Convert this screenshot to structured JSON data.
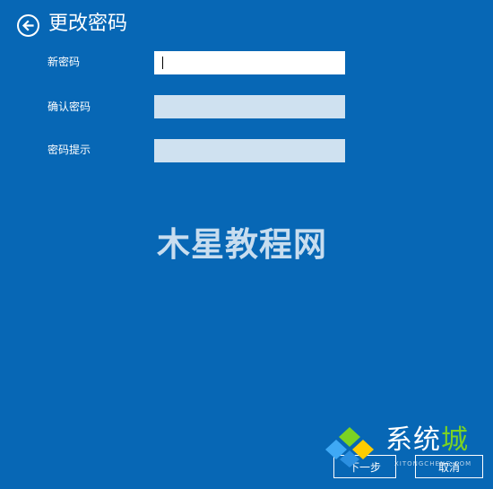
{
  "header": {
    "title": "更改密码",
    "back_icon": "back-arrow-icon"
  },
  "form": {
    "new_password_label": "新密码",
    "new_password_value": "",
    "confirm_password_label": "确认密码",
    "confirm_password_value": "",
    "password_hint_label": "密码提示",
    "password_hint_value": ""
  },
  "watermark": {
    "text": "木星教程网"
  },
  "buttons": {
    "next_label": "下一步",
    "cancel_label": "取消"
  },
  "corner_logo": {
    "text_main": "系统",
    "text_accent": "城",
    "subtext": "XITONGCHENG.COM"
  },
  "colors": {
    "background": "#0767b5",
    "input_active": "#ffffff",
    "input_inactive": "#cfe1f0",
    "logo_accent": "#7bd323"
  }
}
